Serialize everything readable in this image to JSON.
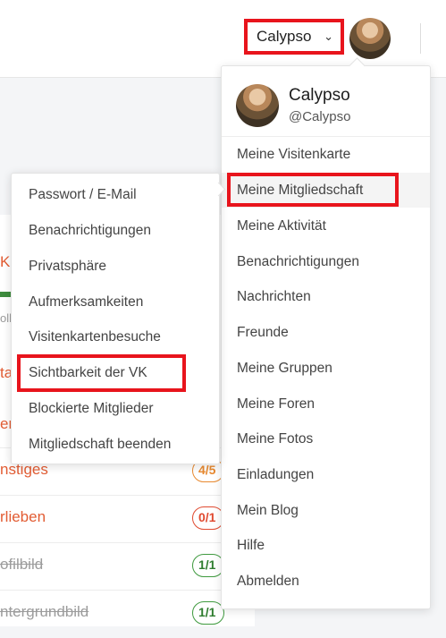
{
  "header": {
    "user_select_value": "Calypso",
    "chevron": "⌄",
    "avatar_icon": "user-avatar"
  },
  "profile": {
    "name": "Calypso",
    "handle": "@Calypso"
  },
  "main_menu": {
    "items": [
      "Meine Visitenkarte",
      "Meine Mitgliedschaft",
      "Meine Aktivität",
      "Benachrichtigungen",
      "Nachrichten",
      "Freunde",
      "Meine Gruppen",
      "Meine Foren",
      "Meine Fotos",
      "Einladungen",
      "Mein Blog",
      "Hilfe",
      "Abmelden"
    ]
  },
  "sub_menu": {
    "items": [
      "Passwort / E-Mail",
      "Benachrichtigungen",
      "Privatsphäre",
      "Aufmerksamkeiten",
      "Visitenkartenbesuche",
      "Sichtbarkeit der VK",
      "Blockierte Mitglieder",
      "Mitgliedschaft beenden"
    ]
  },
  "background": {
    "tab_fragment": "K",
    "caption_fragment": "oll",
    "frag1": "ta",
    "frag2": "er",
    "rows": [
      {
        "label": "nstiges",
        "badge": "4/5"
      },
      {
        "label": "rlieben",
        "badge": "0/1"
      },
      {
        "label": "ofilbild",
        "badge": "1/1"
      },
      {
        "label": "ntergrundbild",
        "badge": "1/1"
      }
    ]
  },
  "colors": {
    "highlight_red": "#e8141c",
    "accent_orange": "#e25c33",
    "success_green": "#3f9a3f"
  }
}
